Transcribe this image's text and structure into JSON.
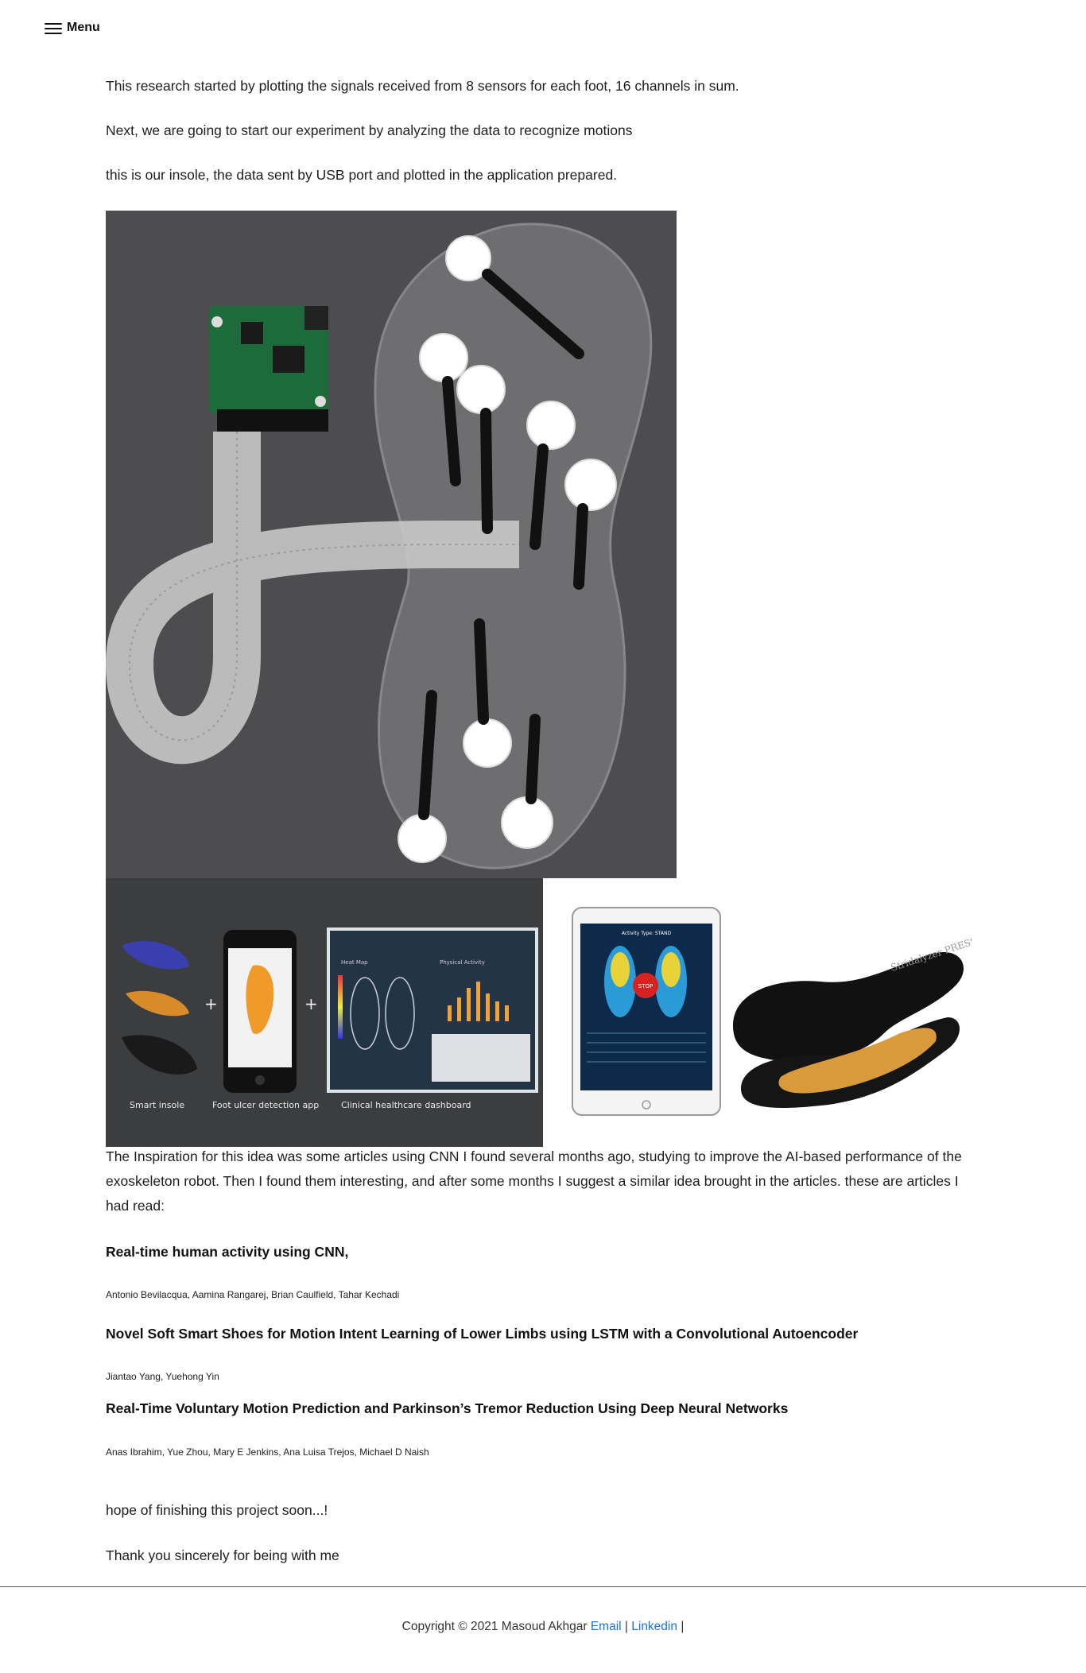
{
  "header": {
    "menu_label": "Menu",
    "menu_icon": "hamburger-icon"
  },
  "intro": {
    "p1": "This research started by plotting the signals received from 8 sensors for each foot, 16 channels in sum.",
    "p2": "Next, we are going to start our experiment by analyzing the data to recognize motions",
    "p3": "this is our insole, the data sent by USB port and plotted in the application prepared."
  },
  "figure_grid": {
    "labels": [
      "Smart insole",
      "Foot ulcer detection app",
      "Clinical healthcare dashboard"
    ],
    "dashboard_header": "Heat Map",
    "dashboard_subheader": "Physical Activity"
  },
  "tablet": {
    "title": "Activity Type: STAND",
    "stop_label": "STOP"
  },
  "shoe": {
    "brand": "Stridalyzer PRESSURE"
  },
  "inspiration": "The Inspiration for this idea was some articles using CNN I found several months ago, studying to improve the AI-based performance of the exoskeleton robot. Then I found them interesting, and after some months I suggest a similar idea brought in the articles. these are articles I had read:",
  "references": [
    {
      "title": "Real-time human activity using CNN,",
      "authors": "Antonio Bevilacqua, Aamina Rangarej, Brian Caulfield, Tahar Kechadi"
    },
    {
      "title": "Novel Soft Smart Shoes for Motion Intent Learning of Lower Limbs using LSTM with a Convolutional Autoencoder",
      "authors": "Jiantao Yang, Yuehong Yin"
    },
    {
      "title": "Real-Time Voluntary Motion Prediction and Parkinson’s Tremor Reduction Using Deep Neural Networks",
      "authors": "Anas Ibrahim, Yue Zhou, Mary E Jenkins, Ana Luisa Trejos, Michael D Naish"
    }
  ],
  "closing": {
    "p1": "hope of finishing this project soon...!",
    "p2": "Thank you sincerely for being with me"
  },
  "footer": {
    "copyright": "Copyright © 2021 Masoud Akhgar",
    "email_label": "Email",
    "separator": "|",
    "linkedin_label": "Linkedin",
    "trailing_separator": "|"
  }
}
